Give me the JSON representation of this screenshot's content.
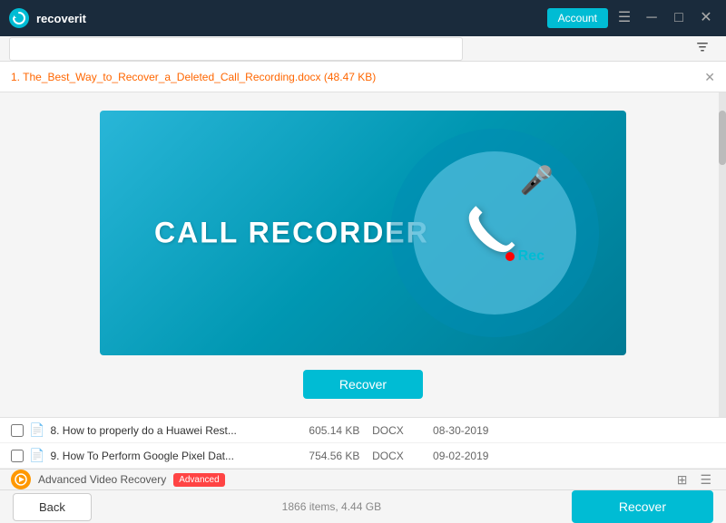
{
  "titleBar": {
    "appName": "recoverit",
    "accountLabel": "Account",
    "menuIcon": "☰",
    "minimizeIcon": "─",
    "maximizeIcon": "□",
    "closeIcon": "✕"
  },
  "searchBar": {
    "placeholder": "",
    "filterIcon": "filter"
  },
  "fileTab": {
    "name": "1. The_Best_Way_to_Recover_a_Deleted_Call_Recording.docx",
    "size": "(48.47 KB)"
  },
  "preview": {
    "callRecorderText": "CALL RECORDER",
    "recLabel": "Rec",
    "recoverButtonLabel": "Recover"
  },
  "fileList": {
    "items": [
      {
        "index": 8,
        "name": "8. How to properly do a Huawei Rest...",
        "size": "605.14 KB",
        "type": "DOCX",
        "date": "08-30-2019"
      },
      {
        "index": 9,
        "name": "9. How To Perform Google Pixel Dat...",
        "size": "754.56 KB",
        "type": "DOCX",
        "date": "09-02-2019"
      }
    ]
  },
  "advancedBar": {
    "label": "Advanced Video Recovery",
    "badge": "Advanced"
  },
  "bottomBar": {
    "itemsCount": "1866 items, 4.44 GB",
    "backLabel": "Back",
    "recoverLabel": "Recover"
  }
}
